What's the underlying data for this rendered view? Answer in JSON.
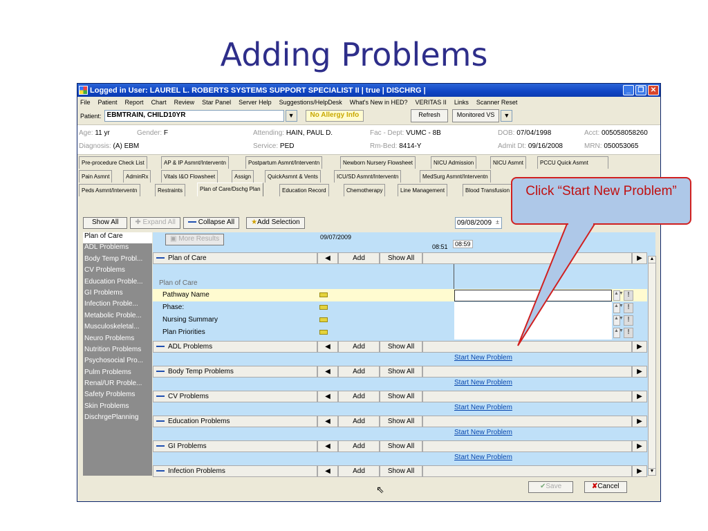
{
  "slide": {
    "title": "Adding Problems"
  },
  "window": {
    "title": "Logged in User: LAUREL L. ROBERTS SYSTEMS SUPPORT SPECIALIST II | true | DISCHRG |"
  },
  "menu": [
    "File",
    "Patient",
    "Report",
    "Chart",
    "Review",
    "Star Panel",
    "Server Help",
    "Suggestions/HelpDesk",
    "What's New in HED?",
    "VERITAS II",
    "Links",
    "Scanner Reset"
  ],
  "patient": {
    "label": "Patient:",
    "name": "EBMTRAIN, CHILD10YR",
    "allergy": "No Allergy Info",
    "refresh": "Refresh",
    "monitored": "Monitored VS"
  },
  "demographics": {
    "age_label": "Age:",
    "age": "11 yr",
    "gender_label": "Gender:",
    "gender": "F",
    "attending_label": "Attending:",
    "attending": "HAIN, PAUL D.",
    "fac_label": "Fac - Dept:",
    "fac": "VUMC - 8B",
    "dob_label": "DOB:",
    "dob": "07/04/1998",
    "acct_label": "Acct:",
    "acct": "005058058260",
    "diagnosis_label": "Diagnosis:",
    "diagnosis": "(A) EBM",
    "service_label": "Service:",
    "service": "PED",
    "rmbed_label": "Rm-Bed:",
    "rmbed": "8414-Y",
    "admit_label": "Admit Dt:",
    "admit": "09/16/2008",
    "mrn_label": "MRN:",
    "mrn": "050053065"
  },
  "tabs": {
    "row1": [
      "Pre-procedure Check List",
      "AP & IP Asmnt/Interventn",
      "Postpartum Asmnt/Interventn",
      "Newborn Nursery Flowsheet",
      "NICU Admission",
      "NICU Asmnt",
      "PCCU Quick Asmnt"
    ],
    "row2": [
      "Pain Asmnt",
      "AdminRx",
      "Vitals I&O Flowsheet",
      "Assign",
      "QuickAsmnt & Vents",
      "ICU/SD Asmnt/Interventn",
      "MedSurg Asmnt/Interventn"
    ],
    "row3": [
      "Peds Asmnt/Interventn",
      "Restraints",
      "Plan of Care/Dschg Plan",
      "Education Record",
      "Chemotherapy",
      "Line Management",
      "Blood Transfusion"
    ]
  },
  "toolbar": {
    "show_all": "Show All",
    "expand_all": "Expand All",
    "collapse_all": "Collapse All",
    "add_selection": "Add Selection",
    "date1": "09/07/2009",
    "time1": "08:51",
    "date2": "09/08/2009",
    "time2": "08:59"
  },
  "sidebar": [
    "Plan of Care",
    "ADL Problems",
    "Body Temp Probl...",
    "CV Problems",
    "Education Proble...",
    "GI Problems",
    "Infection Proble...",
    "Metabolic Proble...",
    "Musculoskeletal...",
    "Neuro Problems",
    "Nutrition Problems",
    "Psychosocial Pro...",
    "Pulm Problems",
    "Renal/UR Proble...",
    "Safety Problems",
    "Skin Problems",
    "DischrgePlanning"
  ],
  "grid": {
    "add": "Add",
    "show_all": "Show All",
    "plan_header": "Plan of Care",
    "plan_section": "Plan of Care",
    "plan_fields": [
      "Pathway Name",
      "Phase:",
      "Nursing Summary",
      "Plan Priorities"
    ],
    "groups": [
      "ADL Problems",
      "Body Temp Problems",
      "CV Problems",
      "Education Problems",
      "GI Problems",
      "Infection Problems"
    ],
    "start_new": "Start New Problem"
  },
  "footer": {
    "save": "Save",
    "cancel": "Cancel"
  },
  "callout": {
    "text": "Click “Start New Problem”"
  },
  "colors": {
    "accent": "#2e2e8a",
    "grid_bg": "#bfe0f8",
    "callout_border": "#d02020"
  }
}
